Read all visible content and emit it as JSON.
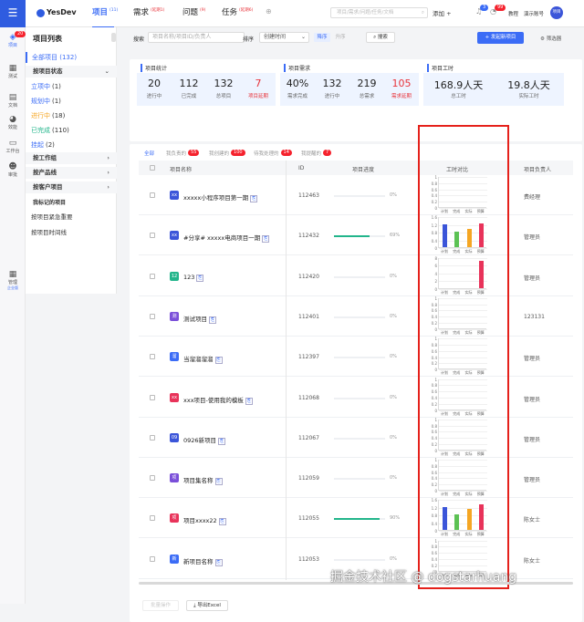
{
  "topbar": {
    "brand": "YesDev",
    "nav": [
      {
        "label": "项目",
        "count": "(11)",
        "active": true
      },
      {
        "label": "需求",
        "count": "(延期1)",
        "active": false
      },
      {
        "label": "问题",
        "count": "(9)",
        "active": false
      },
      {
        "label": "任务",
        "count": "(延期6)",
        "active": false
      }
    ],
    "search_placeholder": "项目/需求/问题/任务/文档",
    "add_label": "添加",
    "bell_badge": "3",
    "clock_badge": "99",
    "tutorial": "教程",
    "account": "演示账号",
    "avatar_text": "项目"
  },
  "rail": [
    {
      "label": "项目",
      "icon": "project-icon",
      "badge": "20",
      "active": true
    },
    {
      "label": "测试",
      "icon": "test-icon"
    },
    {
      "label": "文档",
      "icon": "document-icon"
    },
    {
      "label": "效能",
      "icon": "pie-chart-icon"
    },
    {
      "label": "工作台",
      "icon": "monitor-icon"
    },
    {
      "label": "审批",
      "icon": "approval-icon"
    },
    {
      "label": "管理",
      "sub": "企业版",
      "icon": "grid-icon"
    }
  ],
  "sidebar": {
    "title": "项目列表",
    "all": "全部项目 (132)",
    "group_status": "按项目状态",
    "statuses": [
      {
        "label": "立项中",
        "count": "(1)",
        "color": "#3b6cf6"
      },
      {
        "label": "规划中",
        "count": "(1)",
        "color": "#3b6cf6"
      },
      {
        "label": "进行中",
        "count": "(18)",
        "color": "#f5a623"
      },
      {
        "label": "已完成",
        "count": "(110)",
        "color": "#22b58b"
      },
      {
        "label": "挂起",
        "count": "(2)",
        "color": "#3b6cf6"
      }
    ],
    "groups": [
      "按工作组",
      "按产品线",
      "按客户项目"
    ],
    "marked": "我标记的项目",
    "links": [
      "按项目紧急重要",
      "按项目时间线"
    ]
  },
  "filter": {
    "search_label": "搜索",
    "search_placeholder": "项目名称/项目ID/负责人",
    "sort_label": "排序",
    "sort_value": "创建时间",
    "asc": "降序",
    "desc": "升序",
    "search_btn": "搜索",
    "new_btn": "+ 发起新项目",
    "filter_btn": "筛选器"
  },
  "stats": {
    "project": {
      "title": "项目统计",
      "items": [
        {
          "value": "20",
          "label": "进行中"
        },
        {
          "value": "112",
          "label": "已完成"
        },
        {
          "value": "132",
          "label": "总项目"
        },
        {
          "value": "7",
          "label": "项目延期",
          "red": true
        }
      ]
    },
    "demand": {
      "title": "项目需求",
      "items": [
        {
          "value": "40%",
          "label": "需求完成"
        },
        {
          "value": "132",
          "label": "进行中"
        },
        {
          "value": "219",
          "label": "总需求"
        },
        {
          "value": "105",
          "label": "需求延期",
          "red": true
        }
      ]
    },
    "hours": {
      "title": "项目工时",
      "items": [
        {
          "value": "168.9人天",
          "label": "总工时"
        },
        {
          "value": "19.8人天",
          "label": "实际工时"
        }
      ]
    }
  },
  "tabs": [
    {
      "label": "全部",
      "badge": ""
    },
    {
      "label": "我负责的",
      "badge": "55"
    },
    {
      "label": "我创建的",
      "badge": "100"
    },
    {
      "label": "待我处理的",
      "badge": "14"
    },
    {
      "label": "我提醒的",
      "badge": "7"
    }
  ],
  "table": {
    "headers": [
      "项目名称",
      "ID",
      "项目进度",
      "工时对比",
      "项目负责人"
    ],
    "rows": [
      {
        "tag": "xx",
        "tag_color": "#3b55d9",
        "name": "xxxxx小程序项目第一期",
        "id": "112463",
        "progress": 0,
        "pct": "0%",
        "owner": "费经理",
        "hours": [
          0,
          0,
          0,
          0
        ]
      },
      {
        "tag": "xx",
        "tag_color": "#3b55d9",
        "name": "#分享# xxxxx电商项目一期",
        "id": "112432",
        "progress": 69,
        "pct": "69%",
        "owner": "管理员",
        "hours": [
          1.2,
          0.8,
          0.95,
          1.25
        ]
      },
      {
        "tag": "12",
        "tag_color": "#22b58b",
        "name": "123",
        "id": "112420",
        "progress": 0,
        "pct": "0%",
        "owner": "管理员",
        "hours": [
          0,
          0,
          0,
          7
        ]
      },
      {
        "tag": "测",
        "tag_color": "#7a4fd9",
        "name": "测试项目",
        "id": "112401",
        "progress": 0,
        "pct": "0%",
        "owner": "123131",
        "hours": [
          0,
          0,
          0,
          0
        ]
      },
      {
        "tag": "溜",
        "tag_color": "#3b6cf6",
        "name": "当溜溜溜溜",
        "id": "112397",
        "progress": 0,
        "pct": "0%",
        "owner": "管理员",
        "hours": [
          0,
          0,
          0,
          0
        ]
      },
      {
        "tag": "xx",
        "tag_color": "#e8335a",
        "name": "xxx项目-使用我的模板",
        "id": "112068",
        "progress": 0,
        "pct": "0%",
        "owner": "管理员",
        "hours": [
          0,
          0,
          0,
          0
        ]
      },
      {
        "tag": "09",
        "tag_color": "#3b55d9",
        "name": "0926新项目",
        "id": "112067",
        "progress": 0,
        "pct": "0%",
        "owner": "管理员",
        "hours": [
          0,
          0,
          0,
          0
        ]
      },
      {
        "tag": "项",
        "tag_color": "#7a4fd9",
        "name": "项目集名称",
        "id": "112059",
        "progress": 0,
        "pct": "0%",
        "owner": "管理员",
        "hours": [
          0,
          0,
          0,
          0
        ]
      },
      {
        "tag": "项",
        "tag_color": "#e8335a",
        "name": "项目xxxx22",
        "id": "112055",
        "progress": 90,
        "pct": "90%",
        "owner": "陈女士",
        "hours": [
          1.2,
          0.8,
          1.1,
          1.35
        ]
      },
      {
        "tag": "新",
        "tag_color": "#3b6cf6",
        "name": "新项目名称",
        "id": "112053",
        "progress": 0,
        "pct": "0%",
        "owner": "陈女士",
        "hours": [
          0,
          0,
          0,
          0
        ]
      }
    ]
  },
  "mini_chart": {
    "x": [
      "计划",
      "完成",
      "实际",
      "预算"
    ],
    "yticks": [
      "1",
      "0.8",
      "0.6",
      "0.4",
      "0.2",
      "0"
    ],
    "yticks_big": [
      "1.6",
      "1.2",
      "0.8",
      "0.4",
      "0"
    ],
    "yticks_7": [
      "8",
      "6",
      "4",
      "2",
      "0"
    ],
    "colors": [
      "#3b55d9",
      "#5cc254",
      "#f5a623",
      "#e8335a"
    ]
  },
  "footer": {
    "export_btn": "导出Excel",
    "batch": "批量操作",
    "watermark": "掘金技术社区 @ dogstarhuang"
  }
}
